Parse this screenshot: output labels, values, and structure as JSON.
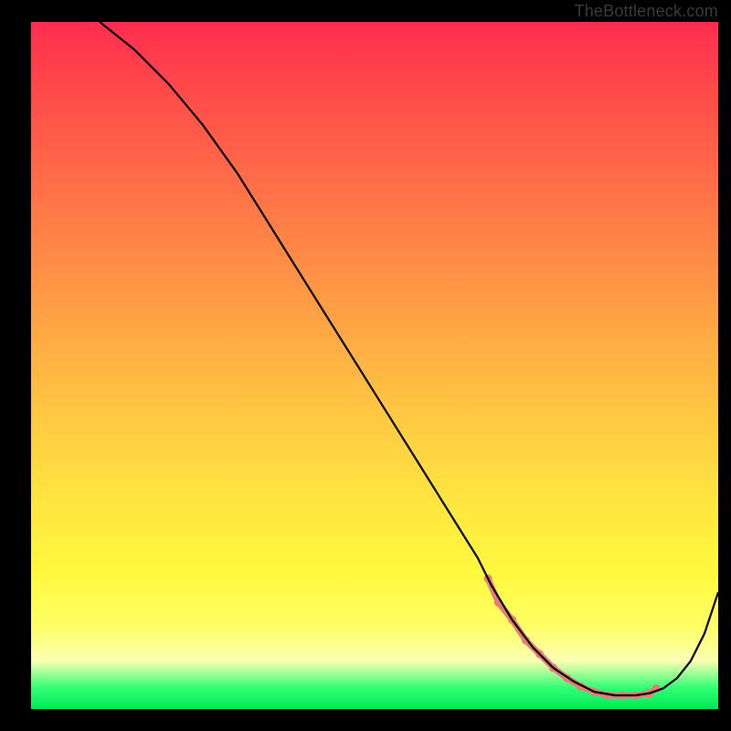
{
  "attribution": "TheBottleneck.com",
  "chart_data": {
    "type": "line",
    "title": "",
    "xlabel": "",
    "ylabel": "",
    "xlim": [
      0,
      100
    ],
    "ylim": [
      0,
      100
    ],
    "grid": false,
    "series": [
      {
        "name": "curve",
        "x": [
          10,
          15,
          20,
          25,
          30,
          35,
          40,
          45,
          50,
          55,
          60,
          65,
          67,
          70,
          73,
          76,
          79,
          82,
          85,
          88,
          90,
          92,
          94,
          96,
          98,
          100
        ],
        "y": [
          100,
          96,
          91,
          85,
          78,
          70,
          62,
          54,
          46,
          38,
          30,
          22,
          18,
          13,
          9,
          6,
          4,
          2.5,
          2,
          2,
          2.3,
          3,
          4.5,
          7,
          11,
          17
        ],
        "stroke": "#000000",
        "stroke_width": 2.2
      }
    ],
    "markers": {
      "points_x": [
        66.5,
        68,
        70,
        72,
        74,
        76,
        78,
        80,
        82,
        84,
        86,
        88,
        90,
        91
      ],
      "points_y": [
        19,
        15.5,
        13,
        10,
        8,
        6,
        4.5,
        3.3,
        2.5,
        2.0,
        2.0,
        2.0,
        2.3,
        3.0
      ],
      "color": "#e77a7a",
      "size": 9
    },
    "colors": {
      "gradient_top": "#ff2d4f",
      "gradient_bottom": "#00e85a",
      "background": "#000000"
    }
  }
}
